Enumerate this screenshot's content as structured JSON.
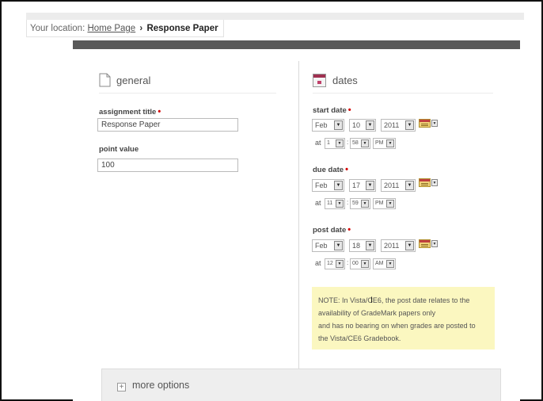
{
  "breadcrumb": {
    "prefix": "Your location:",
    "home": "Home Page",
    "separator": "›",
    "current": "Response Paper"
  },
  "general": {
    "heading": "general",
    "title_label": "assignment title",
    "title_value": "Response Paper",
    "points_label": "point value",
    "points_value": "100"
  },
  "dates": {
    "heading": "dates",
    "start": {
      "label": "start date",
      "month": "Feb",
      "day": "10",
      "year": "2011",
      "hour": "1",
      "minute": "58",
      "ampm": "PM"
    },
    "due": {
      "label": "due date",
      "month": "Feb",
      "day": "17",
      "year": "2011",
      "hour": "11",
      "minute": "59",
      "ampm": "PM"
    },
    "post": {
      "label": "post date",
      "month": "Feb",
      "day": "18",
      "year": "2011",
      "hour": "12",
      "minute": "00",
      "ampm": "AM"
    },
    "at_label": "at",
    "required_mark": "•"
  },
  "note": {
    "line1": "NOTE: In Vista/CE6, the post date relates to the",
    "line2": "availability of GradeMark papers only",
    "line3": "and has no bearing on when grades are posted to",
    "line4": "the Vista/CE6 Gradebook."
  },
  "more_options": {
    "label": "more options",
    "icon_glyph": "+"
  },
  "icons": {
    "general": "document-icon",
    "dates": "calendar-icon",
    "picker": "calendar-picker-icon",
    "dropdown_glyph": "▼",
    "cursor_glyph": "I"
  },
  "colors": {
    "panel_bar": "#595959",
    "note_bg": "#fbf7c0",
    "required": "#d40000",
    "calendar_accent": "#a03050"
  }
}
